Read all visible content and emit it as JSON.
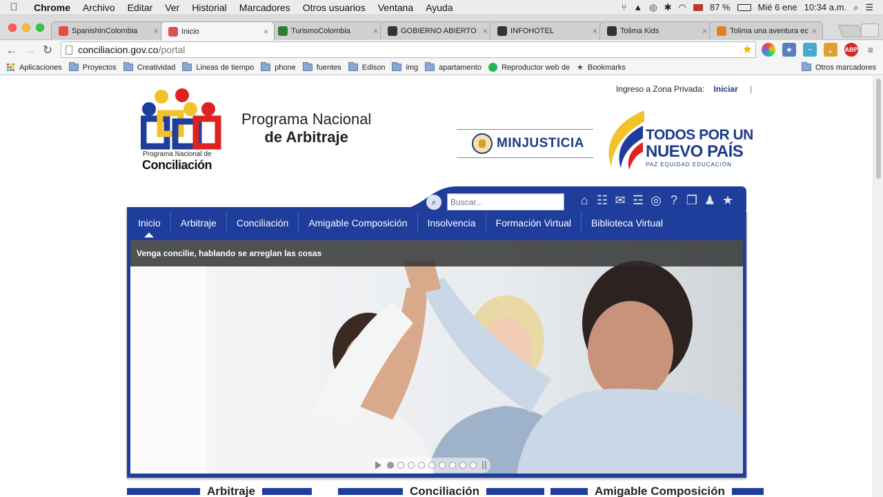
{
  "menubar": {
    "app": "Chrome",
    "items": [
      "Archivo",
      "Editar",
      "Ver",
      "Historial",
      "Marcadores",
      "Otros usuarios",
      "Ventana",
      "Ayuda"
    ],
    "battery": "87 %",
    "date": "Mié 6 ene",
    "time": "10:34 a.m."
  },
  "tabs": [
    {
      "title": "SpanishInColombia",
      "color": "#e74c3c"
    },
    {
      "title": "Inicio",
      "color": "#d9534f",
      "active": true
    },
    {
      "title": "TurismoColombia",
      "color": "#2e7d32"
    },
    {
      "title": "GOBIERNO ABIERTO",
      "color": "#333333"
    },
    {
      "title": "INFOHOTEL",
      "color": "#333333"
    },
    {
      "title": "Tolima Kids",
      "color": "#333333"
    },
    {
      "title": "Tolima una aventura ec",
      "color": "#e67e22"
    }
  ],
  "toolbar": {
    "url_domain": "conciliacion.gov.co",
    "url_path": "/portal"
  },
  "bookmarks": {
    "apps": "Aplicaciones",
    "items": [
      "Proyectos",
      "Creatividad",
      "Lineas de tiempo",
      "phone",
      "fuentes",
      "Edison",
      "img",
      "apartamento",
      "Reproductor web de",
      "Bookmarks"
    ],
    "other": "Otros marcadores"
  },
  "header": {
    "login_label": "Ingreso a Zona Privada:",
    "login_link": "Iniciar",
    "login_sep": "|",
    "concil_line1": "Programa Nacional de",
    "concil_line2": "Conciliación",
    "arbitraje_line1": "Programa Nacional",
    "arbitraje_line2": "de Arbitraje",
    "minjusticia": "MINJUSTICIA",
    "todos_line1": "TODOS POR UN",
    "todos_line2": "NUEVO PAÍS",
    "todos_line3": "PAZ  EQUIDAD  EDUCACIÓN"
  },
  "search": {
    "placeholder": "Buscar..."
  },
  "nav": {
    "items": [
      "Inicio",
      "Arbitraje",
      "Conciliación",
      "Amigable Composición",
      "Insolvencia",
      "Formación Virtual",
      "Biblioteca Virtual"
    ]
  },
  "slider": {
    "caption": "Venga concilie, hablando se arreglan las cosas",
    "slide_count": 9,
    "current_slide": 1
  },
  "sections": [
    "Arbitraje",
    "Conciliación",
    "Amigable Composición"
  ],
  "colors": {
    "brand_blue": "#1f3d9b",
    "link_blue": "#1c3a8a"
  }
}
